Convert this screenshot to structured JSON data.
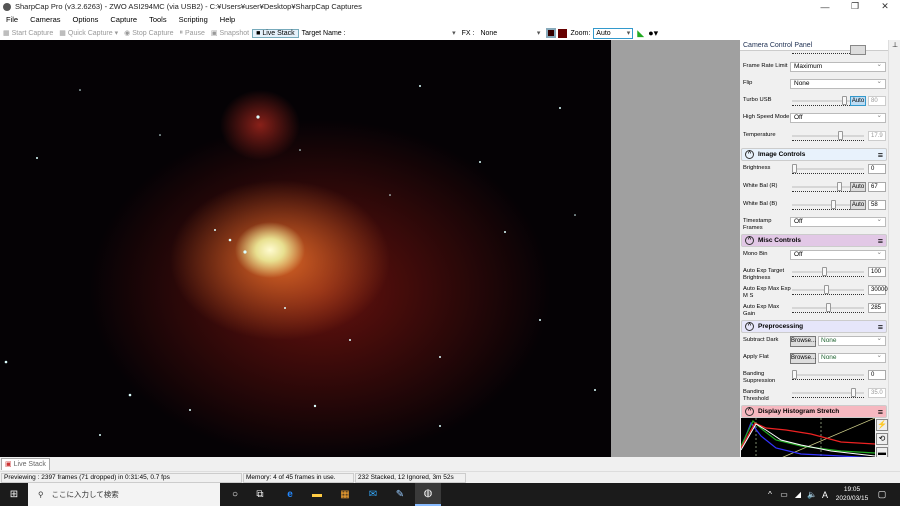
{
  "window": {
    "title": "SharpCap Pro (v3.2.6263) - ZWO ASI294MC (via USB2) - C:¥Users¥user¥Desktop¥SharpCap Captures"
  },
  "menu": [
    "File",
    "Cameras",
    "Options",
    "Capture",
    "Tools",
    "Scripting",
    "Help"
  ],
  "toolbar": {
    "start_capture": "Start Capture",
    "quick_capture": "Quick Capture",
    "stop_capture": "Stop Capture",
    "pause": "Pause",
    "snapshot": "Snapshot",
    "live_stack": "Live Stack",
    "target_name_label": "Target Name :",
    "target_name_value": "",
    "fx_label": "FX :",
    "fx_value": "None",
    "zoom_label": "Zoom:",
    "zoom_value": "Auto"
  },
  "panel": {
    "title": "Camera Control Panel",
    "camera": {
      "frame_rate_limit": {
        "label": "Frame Rate Limit",
        "value": "Maximum"
      },
      "flip": {
        "label": "Flip",
        "value": "None"
      },
      "turbo_usb": {
        "label": "Turbo USB",
        "auto": "Auto",
        "value": "80",
        "level": 0.75
      },
      "high_speed_mode": {
        "label": "High Speed Mode",
        "value": "Off"
      },
      "temperature": {
        "label": "Temperature",
        "value": "17.9",
        "level": 0.68
      }
    },
    "image_controls": {
      "title": "Image Controls",
      "brightness": {
        "label": "Brightness",
        "value": "0",
        "level": 0
      },
      "wb_r": {
        "label": "White Bal (R)",
        "auto": "Auto",
        "value": "67",
        "level": 0.67
      },
      "wb_b": {
        "label": "White Bal (B)",
        "auto": "Auto",
        "value": "58",
        "level": 0.58
      },
      "timestamp": {
        "label": "Timestamp Frames",
        "value": "Off"
      }
    },
    "misc_controls": {
      "title": "Misc Controls",
      "mono_bin": {
        "label": "Mono Bin",
        "value": "Off"
      },
      "ae_target": {
        "label": "Auto Exp Target Brightness",
        "value": "100",
        "level": 0.45
      },
      "ae_max_exp": {
        "label": "Auto Exp Max Exp M S",
        "value": "30000",
        "level": 0.48
      },
      "ae_max_gain": {
        "label": "Auto Exp Max Gain",
        "value": "285",
        "level": 0.5
      }
    },
    "preprocessing": {
      "title": "Preprocessing",
      "subtract_dark": {
        "label": "Subtract Dark",
        "browse": "Browse...",
        "value": "None"
      },
      "apply_flat": {
        "label": "Apply Flat",
        "browse": "Browse...",
        "value": "None"
      },
      "banding_suppression": {
        "label": "Banding Suppression",
        "value": "0",
        "level": 0
      },
      "banding_threshold": {
        "label": "Banding Threshold",
        "value": "35.0",
        "level": 0.88
      }
    },
    "histogram": {
      "title": "Display Histogram Stretch"
    }
  },
  "bottom_tab": "Live Stack",
  "status": {
    "preview": "Previewing : 2397 frames (71 dropped) in 0:31:45, 0.7 fps",
    "memory": "Memory: 4 of 45 frames in use.",
    "stack": "232 Stacked, 12 Ignored, 3m 52s"
  },
  "taskbar": {
    "search_placeholder": "ここに入力して検索",
    "time": "19:05",
    "date": "2020/03/15",
    "ime": "A"
  },
  "colors": {
    "image_controls": "#e8f2fc",
    "misc_controls": "#e2c8e6",
    "preprocessing": "#e6e6fa",
    "histogram": "#f6b8c0"
  }
}
